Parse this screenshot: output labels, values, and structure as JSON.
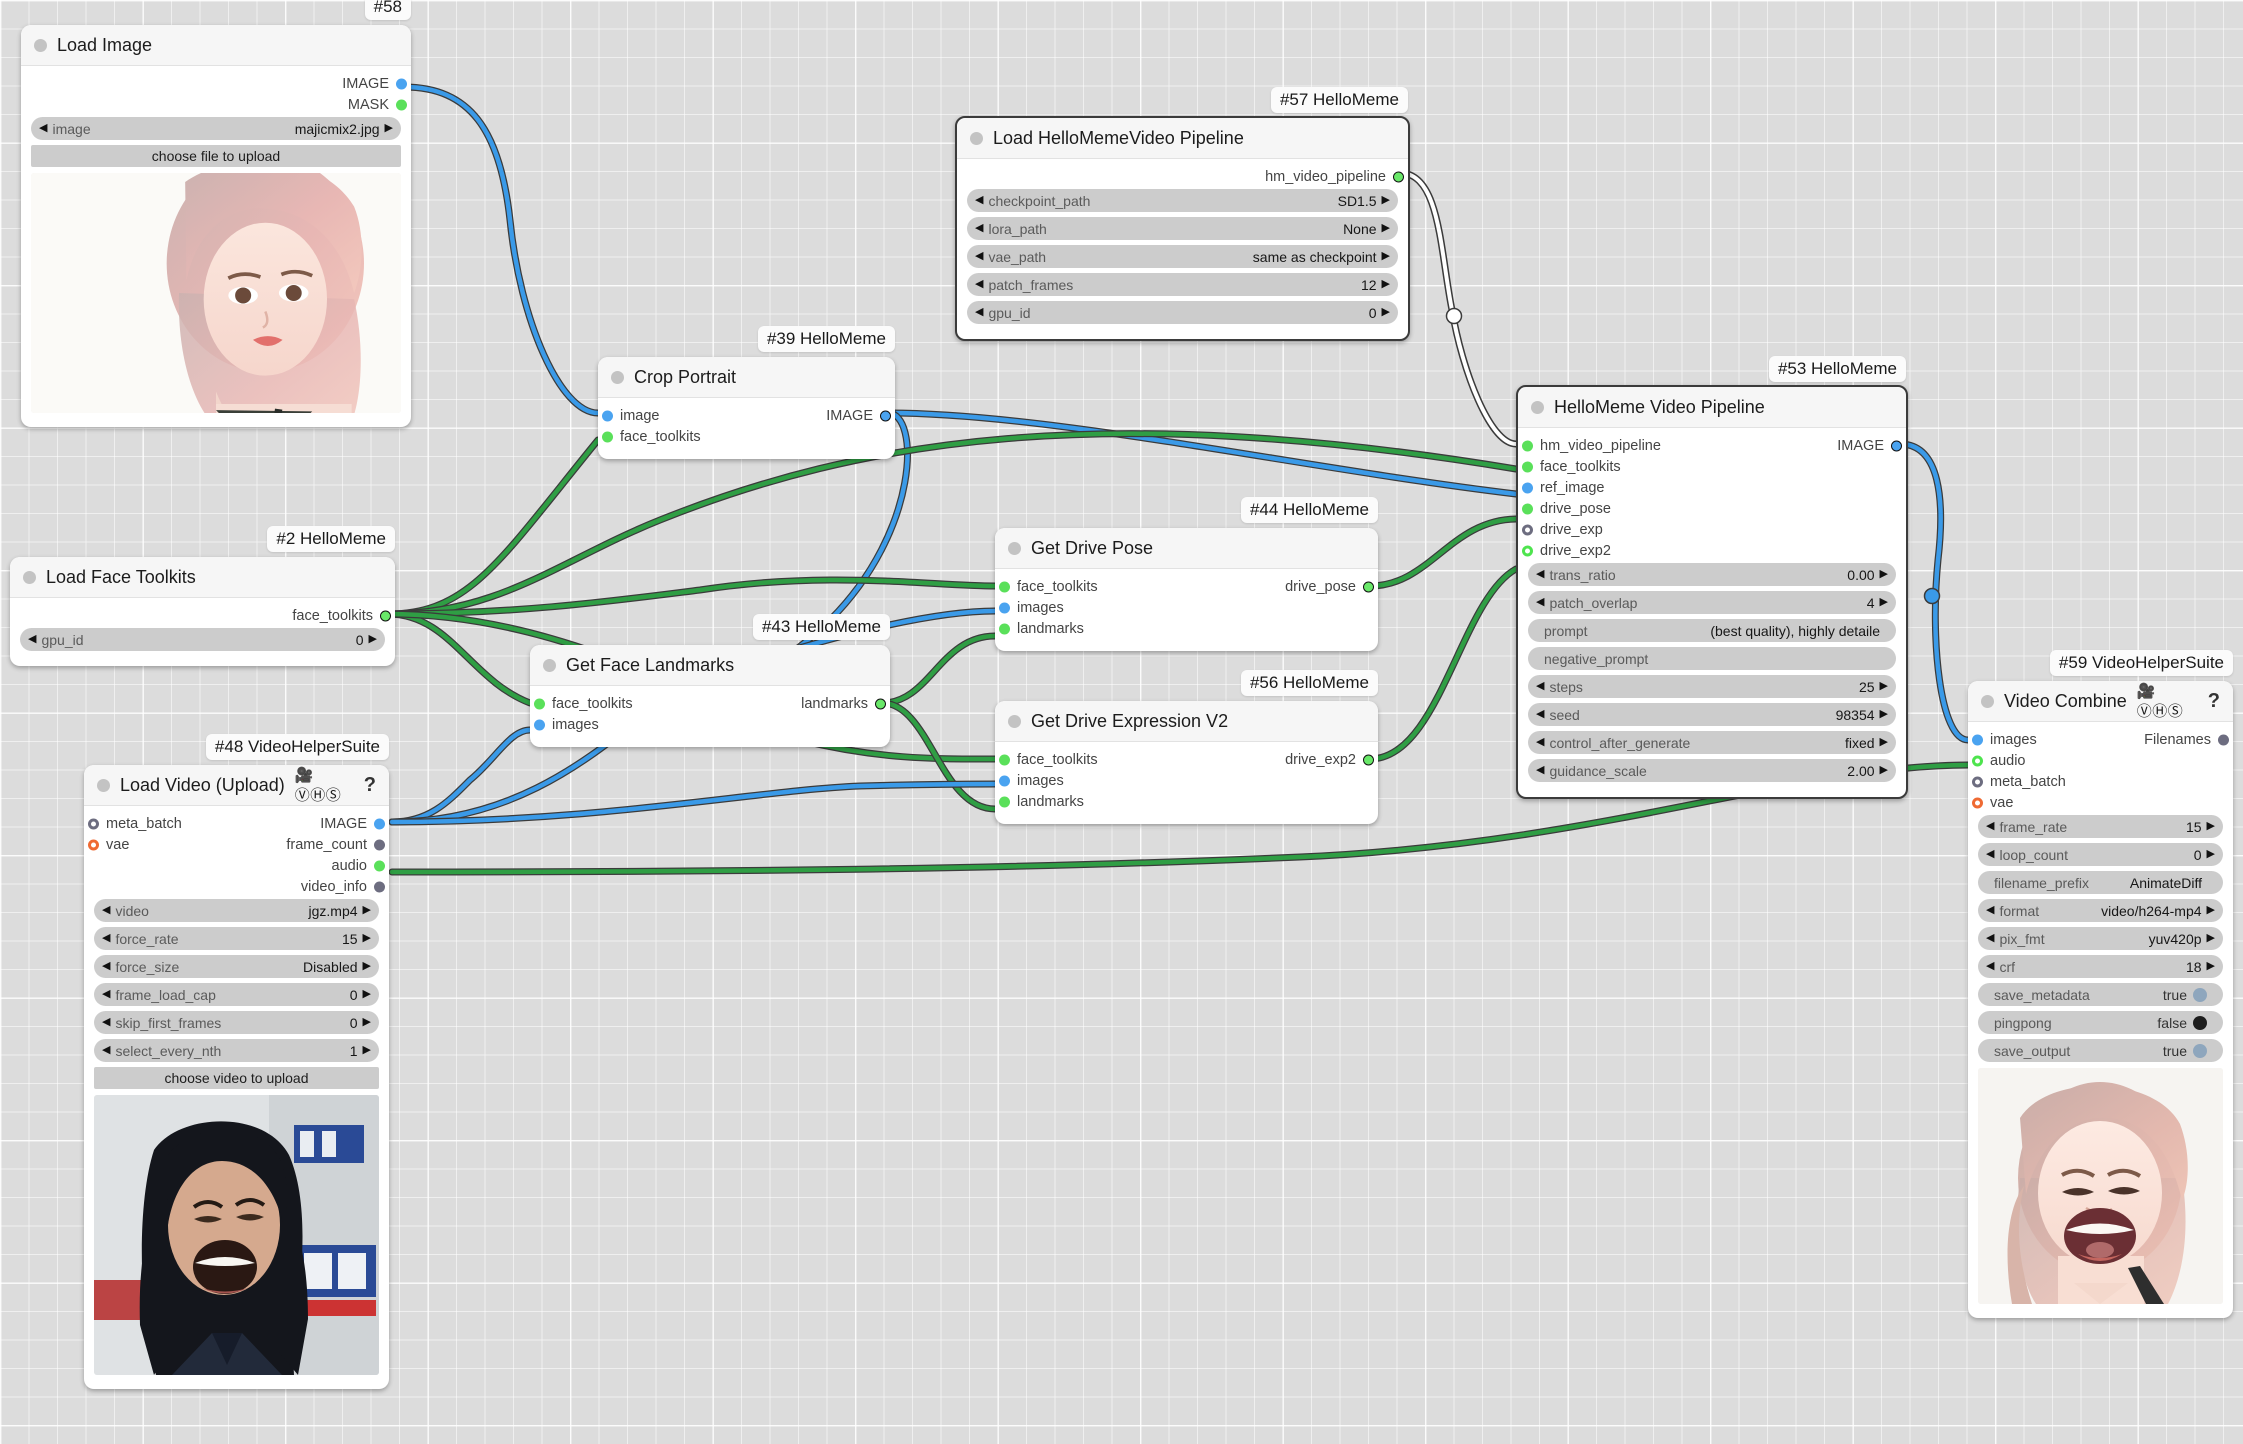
{
  "canvas": {
    "background_color": "#dcdcdc",
    "grid": true
  },
  "nodes": [
    {
      "id": "node-58",
      "badge": "#58",
      "title": "Load Image",
      "outputs": [
        {
          "name": "IMAGE",
          "type": "IMAGE"
        },
        {
          "name": "MASK",
          "type": "MASK"
        }
      ],
      "widgets": [
        {
          "label": "image",
          "value": "majicmix2.jpg"
        }
      ],
      "button": "choose file to upload"
    },
    {
      "id": "node-57",
      "badge": "#57 HelloMeme",
      "title": "Load HelloMemeVideo Pipeline",
      "outputs": [
        {
          "name": "hm_video_pipeline"
        }
      ],
      "widgets": [
        {
          "label": "checkpoint_path",
          "value": "SD1.5"
        },
        {
          "label": "lora_path",
          "value": "None"
        },
        {
          "label": "vae_path",
          "value": "same as checkpoint"
        },
        {
          "label": "patch_frames",
          "value": "12"
        },
        {
          "label": "gpu_id",
          "value": "0"
        }
      ]
    },
    {
      "id": "node-39",
      "badge": "#39 HelloMeme",
      "title": "Crop Portrait",
      "inputs": [
        {
          "name": "image"
        },
        {
          "name": "face_toolkits"
        }
      ],
      "outputs": [
        {
          "name": "IMAGE"
        }
      ]
    },
    {
      "id": "node-53",
      "badge": "#53 HelloMeme",
      "title": "HelloMeme Video Pipeline",
      "inputs": [
        {
          "name": "hm_video_pipeline"
        },
        {
          "name": "face_toolkits"
        },
        {
          "name": "ref_image"
        },
        {
          "name": "drive_pose"
        },
        {
          "name": "drive_exp"
        },
        {
          "name": "drive_exp2"
        }
      ],
      "outputs": [
        {
          "name": "IMAGE"
        }
      ],
      "widgets": [
        {
          "label": "trans_ratio",
          "value": "0.00"
        },
        {
          "label": "patch_overlap",
          "value": "4"
        },
        {
          "label": "prompt",
          "value": "(best quality), highly detaile"
        },
        {
          "label": "negative_prompt",
          "value": ""
        },
        {
          "label": "steps",
          "value": "25"
        },
        {
          "label": "seed",
          "value": "98354"
        },
        {
          "label": "control_after_generate",
          "value": "fixed"
        },
        {
          "label": "guidance_scale",
          "value": "2.00"
        }
      ]
    },
    {
      "id": "node-2",
      "badge": "#2 HelloMeme",
      "title": "Load Face Toolkits",
      "outputs": [
        {
          "name": "face_toolkits"
        }
      ],
      "widgets": [
        {
          "label": "gpu_id",
          "value": "0"
        }
      ]
    },
    {
      "id": "node-44",
      "badge": "#44 HelloMeme",
      "title": "Get Drive Pose",
      "inputs": [
        {
          "name": "face_toolkits"
        },
        {
          "name": "images"
        },
        {
          "name": "landmarks"
        }
      ],
      "outputs": [
        {
          "name": "drive_pose"
        }
      ]
    },
    {
      "id": "node-43",
      "badge": "#43 HelloMeme",
      "title": "Get Face Landmarks",
      "inputs": [
        {
          "name": "face_toolkits"
        },
        {
          "name": "images"
        }
      ],
      "outputs": [
        {
          "name": "landmarks"
        }
      ]
    },
    {
      "id": "node-56",
      "badge": "#56 HelloMeme",
      "title": "Get Drive Expression V2",
      "inputs": [
        {
          "name": "face_toolkits"
        },
        {
          "name": "images"
        },
        {
          "name": "landmarks"
        }
      ],
      "outputs": [
        {
          "name": "drive_exp2"
        }
      ]
    },
    {
      "id": "node-48",
      "badge": "#48 VideoHelperSuite",
      "title": "Load Video (Upload)",
      "title_icons": "🎥ⓋⒽⓈ",
      "help": "?",
      "inputs": [
        {
          "name": "meta_batch"
        },
        {
          "name": "vae"
        }
      ],
      "outputs": [
        {
          "name": "IMAGE"
        },
        {
          "name": "frame_count"
        },
        {
          "name": "audio"
        },
        {
          "name": "video_info"
        }
      ],
      "widgets": [
        {
          "label": "video",
          "value": "jgz.mp4"
        },
        {
          "label": "force_rate",
          "value": "15"
        },
        {
          "label": "force_size",
          "value": "Disabled"
        },
        {
          "label": "frame_load_cap",
          "value": "0"
        },
        {
          "label": "skip_first_frames",
          "value": "0"
        },
        {
          "label": "select_every_nth",
          "value": "1"
        }
      ],
      "button": "choose video to upload"
    },
    {
      "id": "node-59",
      "badge": "#59 VideoHelperSuite",
      "title": "Video Combine",
      "title_icons": "🎥ⓋⒽⓈ",
      "help": "?",
      "inputs": [
        {
          "name": "images"
        },
        {
          "name": "audio"
        },
        {
          "name": "meta_batch"
        },
        {
          "name": "vae"
        }
      ],
      "outputs": [
        {
          "name": "Filenames"
        }
      ],
      "widgets": [
        {
          "label": "frame_rate",
          "value": "15"
        },
        {
          "label": "loop_count",
          "value": "0"
        },
        {
          "label": "filename_prefix",
          "value": "AnimateDiff"
        },
        {
          "label": "format",
          "value": "video/h264-mp4"
        },
        {
          "label": "pix_fmt",
          "value": "yuv420p"
        },
        {
          "label": "crf",
          "value": "18"
        },
        {
          "label": "save_metadata",
          "value": "true"
        },
        {
          "label": "pingpong",
          "value": "false"
        },
        {
          "label": "save_output",
          "value": "true"
        }
      ]
    }
  ],
  "link_colors": {
    "image": "#3a9ae8",
    "toolkits": "#2f9e44",
    "pipeline": "#ffffff"
  }
}
